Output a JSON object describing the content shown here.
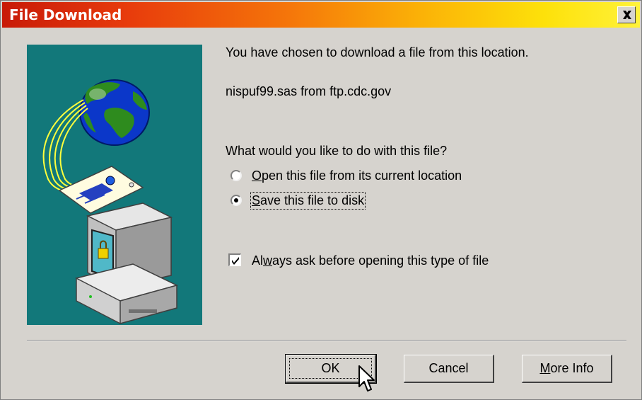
{
  "window": {
    "title": "File Download",
    "close_icon": "close-icon"
  },
  "message": {
    "intro": "You have chosen to download a file from this location.",
    "file": "nispuf99.sas from ftp.cdc.gov",
    "question": "What would you like to do with this file?"
  },
  "options": {
    "open": {
      "accel": "O",
      "rest": "pen this file from its current location",
      "selected": false
    },
    "save": {
      "accel": "S",
      "rest": "ave this file to disk",
      "selected": true
    }
  },
  "always_ask": {
    "pre": "Al",
    "accel": "w",
    "rest": "ays ask before opening this type of file",
    "checked": true
  },
  "buttons": {
    "ok": "OK",
    "cancel": "Cancel",
    "more_info_accel": "M",
    "more_info_rest": "ore Info"
  },
  "colors": {
    "titlebar_start": "#c81a08",
    "titlebar_end": "#fff23a",
    "dialog_bg": "#d6d3ce",
    "art_bg": "#12787a"
  },
  "icons": [
    "globe-icon",
    "document-icon",
    "computer-lock-icon",
    "mouse-cursor-icon"
  ]
}
